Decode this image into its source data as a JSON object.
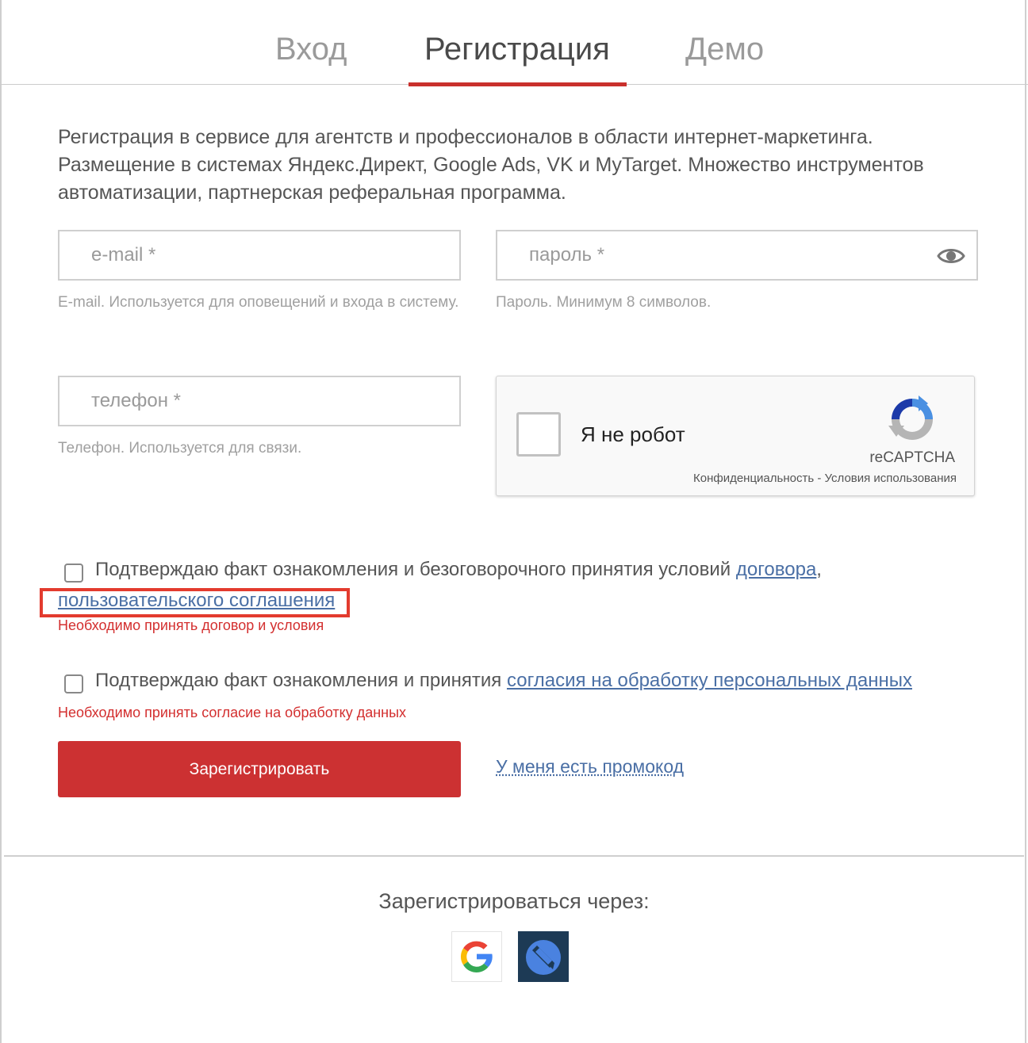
{
  "tabs": [
    {
      "label": "Вход",
      "active": false
    },
    {
      "label": "Регистрация",
      "active": true
    },
    {
      "label": "Демо",
      "active": false
    }
  ],
  "intro": "Регистрация в сервисе для агентств и профессионалов в области интернет-маркетинга. Размещение в системах Яндекс.Директ, Google Ads, VK и MyTarget. Множество инструментов автоматизации, партнерская реферальная программа.",
  "form": {
    "email": {
      "placeholder": "e-mail *",
      "value": "",
      "hint": "E-mail. Используется для оповещений и входа в систему."
    },
    "password": {
      "placeholder": "пароль *",
      "value": "",
      "hint": "Пароль. Минимум 8 символов."
    },
    "phone": {
      "placeholder": "телефон *",
      "value": "",
      "hint": "Телефон. Используется для связи."
    }
  },
  "captcha": {
    "label": "Я не робот",
    "brand": "reCAPTCHA",
    "privacy": "Конфиденциальность",
    "separator": " - ",
    "terms": "Условия использования"
  },
  "agreement1": {
    "text": "Подтверждаю факт ознакомления и безоговорочного принятия условий ",
    "link1": "договора",
    "comma": ",",
    "link2": "пользовательского соглашения",
    "error": "Необходимо принять договор и условия"
  },
  "agreement2": {
    "text": "Подтверждаю факт ознакомления и принятия ",
    "link": "согласия на обработку персональных данных",
    "error": "Необходимо принять согласие на обработку данных"
  },
  "submit_label": "Зарегистрировать",
  "promo_label": "У меня есть промокод",
  "social": {
    "title": "Зарегистрироваться через:",
    "providers": [
      "google-icon",
      "vk-ads-icon"
    ]
  },
  "colors": {
    "accent": "#cc3132",
    "link": "#4a6fa5",
    "error": "#d32f2f",
    "highlight": "#e33b2e"
  }
}
